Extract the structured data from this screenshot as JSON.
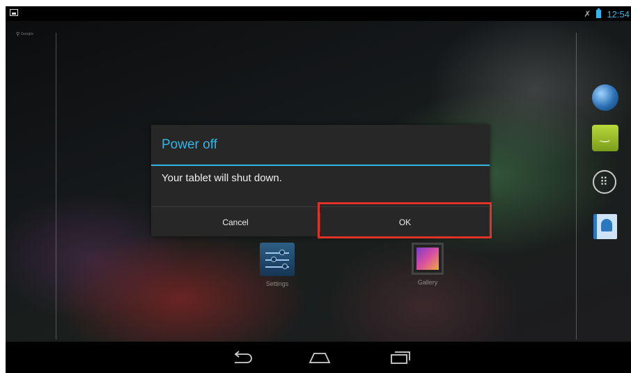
{
  "status_bar": {
    "clock": "12:54",
    "icons": [
      "image-notification-icon",
      "mute-icon",
      "battery-icon"
    ]
  },
  "home": {
    "search_hint": "Google",
    "apps": [
      {
        "label": "Settings",
        "icon": "settings-icon"
      },
      {
        "label": "Gallery",
        "icon": "gallery-icon"
      }
    ],
    "hotseat": [
      "browser-globe-icon",
      "messaging-icon",
      "all-apps-icon",
      "people-icon"
    ]
  },
  "dialog": {
    "title": "Power off",
    "message": "Your tablet will shut down.",
    "cancel_label": "Cancel",
    "ok_label": "OK"
  },
  "nav_bar": {
    "buttons": [
      "back-icon",
      "home-icon",
      "recent-apps-icon"
    ]
  },
  "colors": {
    "accent": "#33b5e5",
    "dialog_bg": "#272727",
    "highlight": "#e03228"
  }
}
